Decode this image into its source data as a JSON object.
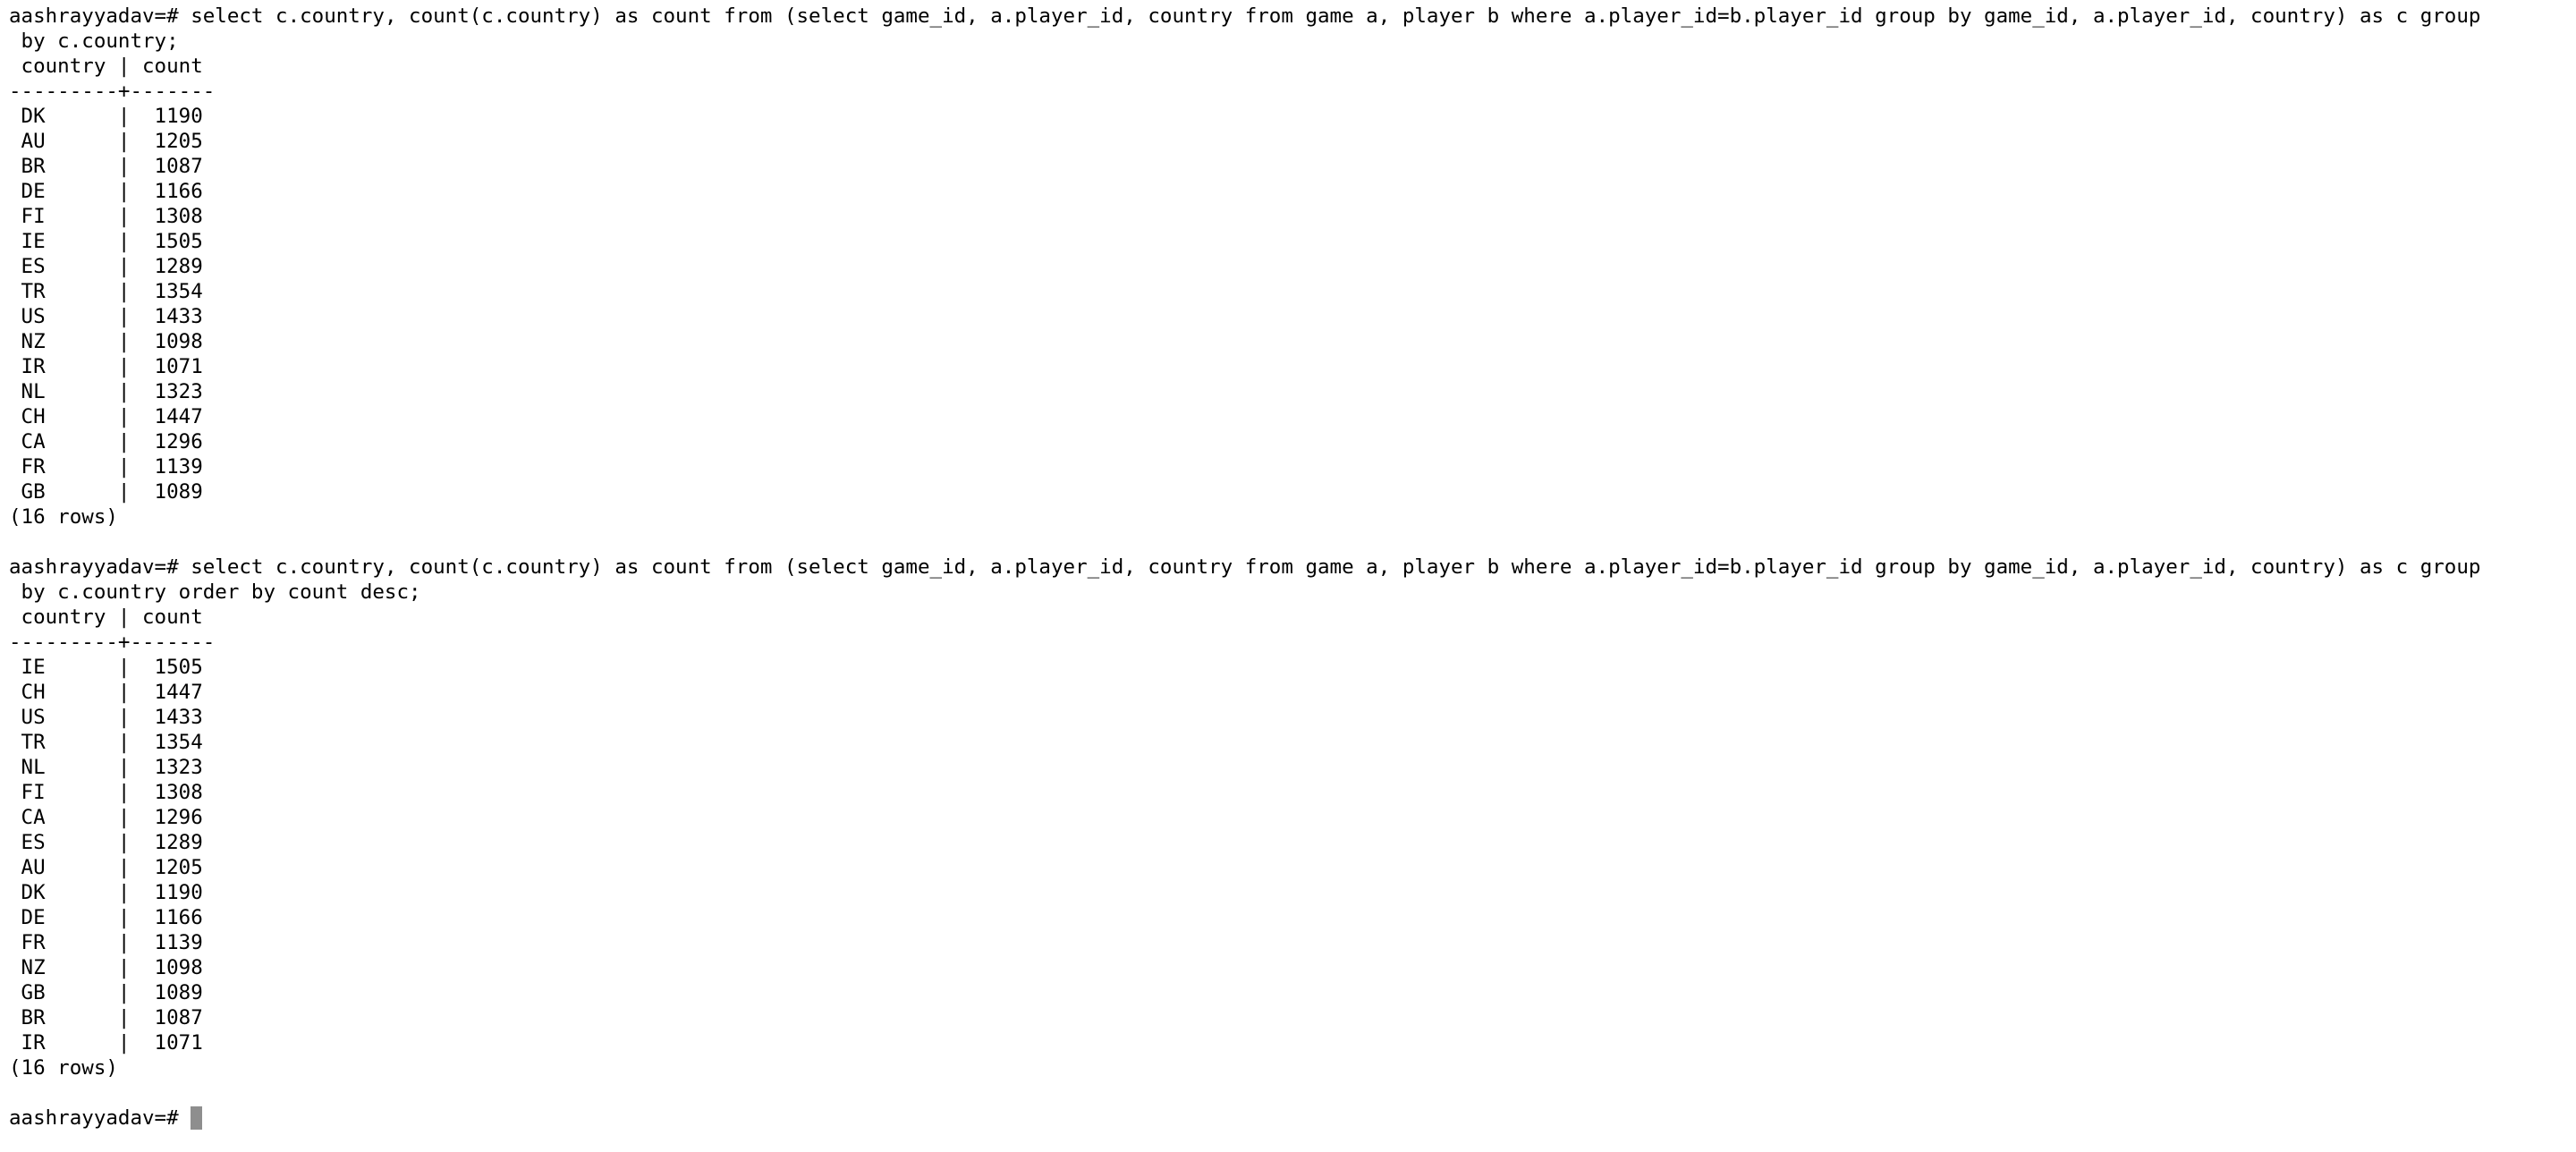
{
  "terminal": {
    "top_mark": "^",
    "prompt": "aashrayyadav=# ",
    "queries": [
      {
        "command": "select c.country, count(c.country) as count from (select game_id, a.player_id, country from game a, player b where a.player_id=b.player_id group by game_id, a.player_id, country) as c group",
        "command_wrap": " by c.country;",
        "header": " country | count ",
        "separator": "---------+-------",
        "rows": [
          " DK      |  1190",
          " AU      |  1205",
          " BR      |  1087",
          " DE      |  1166",
          " FI      |  1308",
          " IE      |  1505",
          " ES      |  1289",
          " TR      |  1354",
          " US      |  1433",
          " NZ      |  1098",
          " IR      |  1071",
          " NL      |  1323",
          " CH      |  1447",
          " CA      |  1296",
          " FR      |  1139",
          " GB      |  1089"
        ],
        "footer": "(16 rows)"
      },
      {
        "command": "select c.country, count(c.country) as count from (select game_id, a.player_id, country from game a, player b where a.player_id=b.player_id group by game_id, a.player_id, country) as c group",
        "command_wrap": " by c.country order by count desc;",
        "header": " country | count ",
        "separator": "---------+-------",
        "rows": [
          " IE      |  1505",
          " CH      |  1447",
          " US      |  1433",
          " TR      |  1354",
          " NL      |  1323",
          " FI      |  1308",
          " CA      |  1296",
          " ES      |  1289",
          " AU      |  1205",
          " DK      |  1190",
          " DE      |  1166",
          " FR      |  1139",
          " NZ      |  1098",
          " GB      |  1089",
          " BR      |  1087",
          " IR      |  1071"
        ],
        "footer": "(16 rows)"
      }
    ],
    "final_prompt": "aashrayyadav=# ",
    "cursor_color": "#8e8e8e"
  }
}
